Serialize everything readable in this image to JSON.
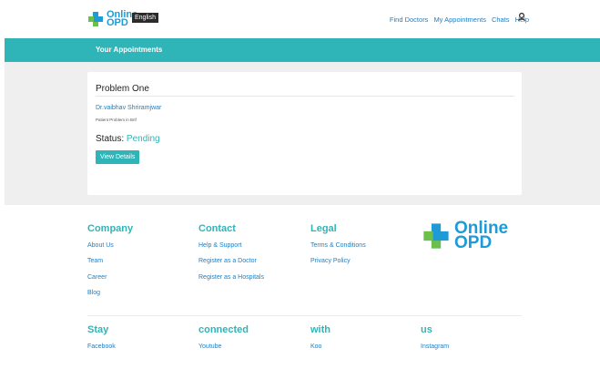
{
  "header": {
    "logo_line1": "Online",
    "logo_line2": "OPD",
    "language": "English",
    "nav": [
      "Find Doctors",
      "My Appointments",
      "Chats",
      "Help"
    ]
  },
  "banner": {
    "title": "Your Appointments"
  },
  "appointment": {
    "title": "Problem One",
    "doctor": "Dr.vaibhav Shriramjwar",
    "problem": "Patient Problem in Brif",
    "status_label": "Status:",
    "status_value": "Pending",
    "button": "View Details"
  },
  "footer": {
    "company": {
      "heading": "Company",
      "links": [
        "About Us",
        "Team",
        "Career",
        "Blog"
      ]
    },
    "contact": {
      "heading": "Contact",
      "links": [
        "Help & Support",
        "Register as a Doctor",
        "Register as a Hospitals"
      ]
    },
    "legal": {
      "heading": "Legal",
      "links": [
        "Terms & Conditions",
        "Privacy Policy"
      ]
    },
    "logo_line1": "Online",
    "logo_line2": "OPD",
    "stay": {
      "headings": [
        "Stay",
        "connected",
        "with",
        "us"
      ],
      "links": [
        "Facebook",
        "Youtube",
        "Koo",
        "Instagram"
      ]
    }
  },
  "colors": {
    "teal": "#2fb5b8",
    "blue": "#1e7fc4",
    "logo_blue": "#1e9bd7",
    "logo_green": "#6cc04a"
  }
}
